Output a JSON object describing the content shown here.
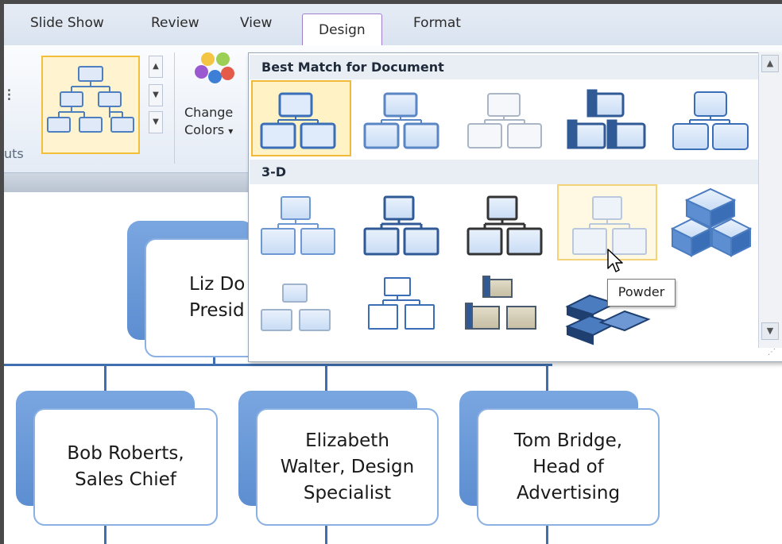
{
  "ribbon": {
    "tabs": [
      {
        "label": "Slide Show"
      },
      {
        "label": "Review"
      },
      {
        "label": "View"
      },
      {
        "label": "Design"
      },
      {
        "label": "Format"
      }
    ],
    "active_tab": "Design",
    "change_colors": {
      "line1": "Change",
      "line2": "Colors",
      "arrow": "▾"
    },
    "group_label": "uts",
    "layout_stub": "⁝"
  },
  "gallery": {
    "sections": [
      {
        "title": "Best Match for Document"
      },
      {
        "title": "3-D"
      }
    ],
    "tooltip": "Powder",
    "selected_style": "Best Match for Document 1",
    "hovered_style": "Powder"
  },
  "org_chart": {
    "top_node": {
      "line1": "Liz Do",
      "line2": "Presid"
    },
    "children": [
      {
        "line1": "Bob Roberts,",
        "line2": "Sales Chief"
      },
      {
        "line1": "Elizabeth",
        "line2": "Walter, Design",
        "line3": "Specialist"
      },
      {
        "line1": "Tom Bridge,",
        "line2": "Head of",
        "line3": "Advertising"
      }
    ]
  },
  "colors": {
    "accent": "#3f6fb0",
    "selection": "#f0b93a",
    "hover": "#f3d27a",
    "shape_fill": "#5d8ed1"
  }
}
